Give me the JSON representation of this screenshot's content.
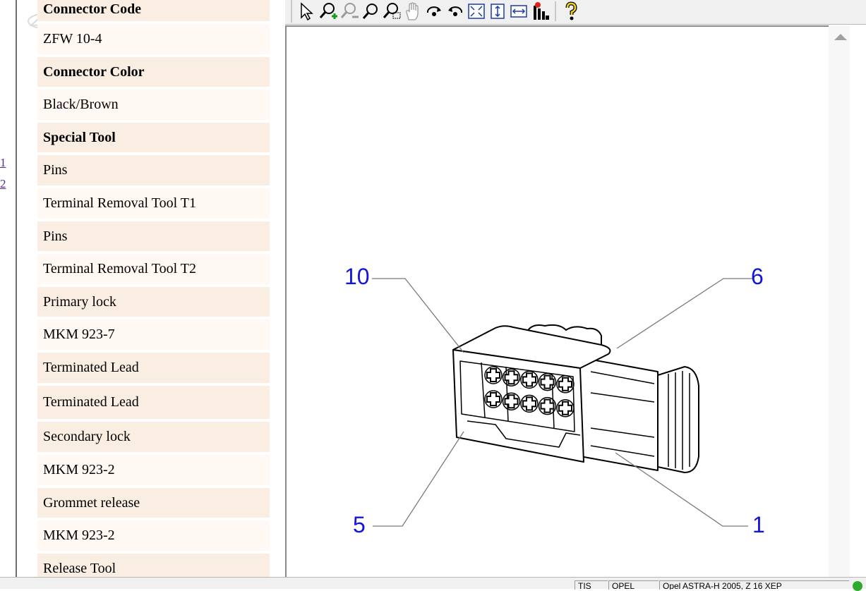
{
  "sidebar": {
    "page_links": [
      "1",
      "2"
    ]
  },
  "info_table": {
    "rows": [
      {
        "text": "Connector Code",
        "bold": true
      },
      {
        "text": "ZFW 10-4",
        "bold": false
      },
      {
        "text": "Connector Color",
        "bold": true
      },
      {
        "text": "Black/Brown",
        "bold": false
      },
      {
        "text": "Special Tool",
        "bold": true
      },
      {
        "text": "Pins",
        "bold": false
      },
      {
        "text": "Terminal Removal Tool T1",
        "bold": false
      },
      {
        "text": "Pins",
        "bold": false
      },
      {
        "text": "Terminal Removal Tool T2",
        "bold": false
      },
      {
        "text": "Primary lock",
        "bold": false
      },
      {
        "text": "MKM 923-7",
        "bold": false
      },
      {
        "text": "Terminated Lead",
        "bold": false
      },
      {
        "text": "Terminated Lead",
        "bold": false
      },
      {
        "text": "Secondary lock",
        "bold": false
      },
      {
        "text": "MKM 923-2",
        "bold": false
      },
      {
        "text": "Grommet release",
        "bold": false
      },
      {
        "text": "MKM 923-2",
        "bold": false
      },
      {
        "text": "Release Tool",
        "bold": false
      }
    ]
  },
  "toolbar": {
    "icons": [
      "select-arrow-icon",
      "zoom-in-icon",
      "zoom-out-icon",
      "zoom-icon",
      "zoom-area-icon",
      "pan-hand-icon",
      "rotate-clockwise-icon",
      "rotate-counterclockwise-icon",
      "fit-window-icon",
      "fit-height-icon",
      "fit-width-icon",
      "layers-icon",
      "help-icon"
    ]
  },
  "diagram": {
    "callouts": {
      "top_left": "10",
      "top_right": "6",
      "bottom_left": "5",
      "bottom_right": "1"
    },
    "callout_color": "#1414dc"
  },
  "status_bar": {
    "cells": [
      "TIS",
      "OPEL",
      "Opel ASTRA-H 2005, Z 16 XEP"
    ]
  },
  "colors": {
    "row_beige": "#faeee2",
    "row_light": "#fff8f3",
    "status_ok": "#2eaa2e"
  }
}
